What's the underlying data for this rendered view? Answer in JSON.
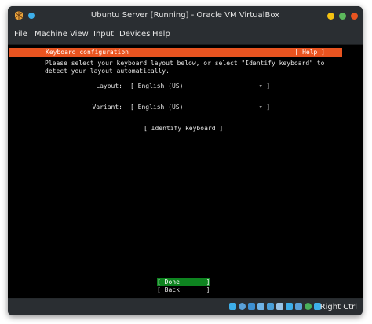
{
  "window": {
    "title": "Ubuntu Server [Running] - Oracle VM VirtualBox"
  },
  "menu": {
    "items": [
      "File",
      "Machine",
      "View",
      "Input",
      "Devices",
      "Help"
    ]
  },
  "installer": {
    "header_title": "Keyboard configuration",
    "help_label": "[ Help ]",
    "description": "Please select your keyboard layout below, or select \"Identify keyboard\" to\ndetect your layout automatically.",
    "layout_label": "Layout:",
    "layout_value": "[ English (US)                    ▾ ]",
    "variant_label": "Variant:",
    "variant_value": "[ English (US)                    ▾ ]",
    "identify_button": "[ Identify keyboard ]",
    "done_button": "[ Done       ]",
    "back_button": "[ Back       ]"
  },
  "statusbar": {
    "host_key": "Right Ctrl"
  },
  "colors": {
    "accent": "#e95420",
    "done": "#0e8420"
  }
}
